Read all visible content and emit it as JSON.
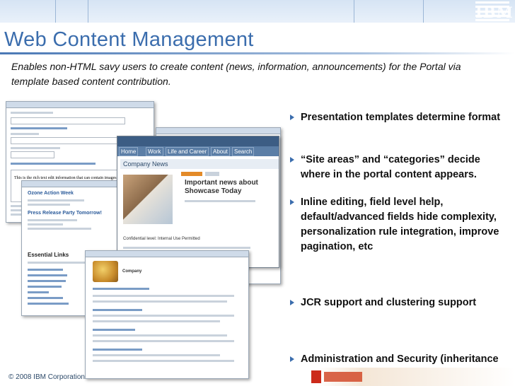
{
  "header": {
    "logo_text": "IBM"
  },
  "slide": {
    "title": "Web Content Management",
    "subtitle": "Enables non-HTML savy users to create content (news, information, announcements) for the Portal via template based content contribution.",
    "bullets": [
      "Presentation templates determine format",
      "“Site areas” and “categories” decide where in the portal content appears.",
      "Inline editing, field level help, default/advanced fields hide complexity, personalization rule integration, improve pagination, etc",
      "JCR support and clustering support",
      "Administration and Security (inheritance model), Authoring"
    ],
    "footer": "© 2008 IBM Corporation"
  },
  "screenshots": {
    "editor_text": "This is the rich text edit information that can contain images, o",
    "nav_items": [
      "Home",
      "Work",
      "Life and Career",
      "About",
      "Search"
    ],
    "company_news": "Company News",
    "news_headline": "Important news about Showcase Today",
    "confidential": "Confidential level: Internal Use Permitted",
    "ozone": "Ozone Action Week",
    "press": "Press Release Party Tomorrow!",
    "essential": "Essential Links",
    "content_viewer": "Company"
  },
  "colors": {
    "title": "#3b6dad",
    "bullet_arrow": "#3b6dad",
    "header_bar": "#d6e4f4"
  }
}
